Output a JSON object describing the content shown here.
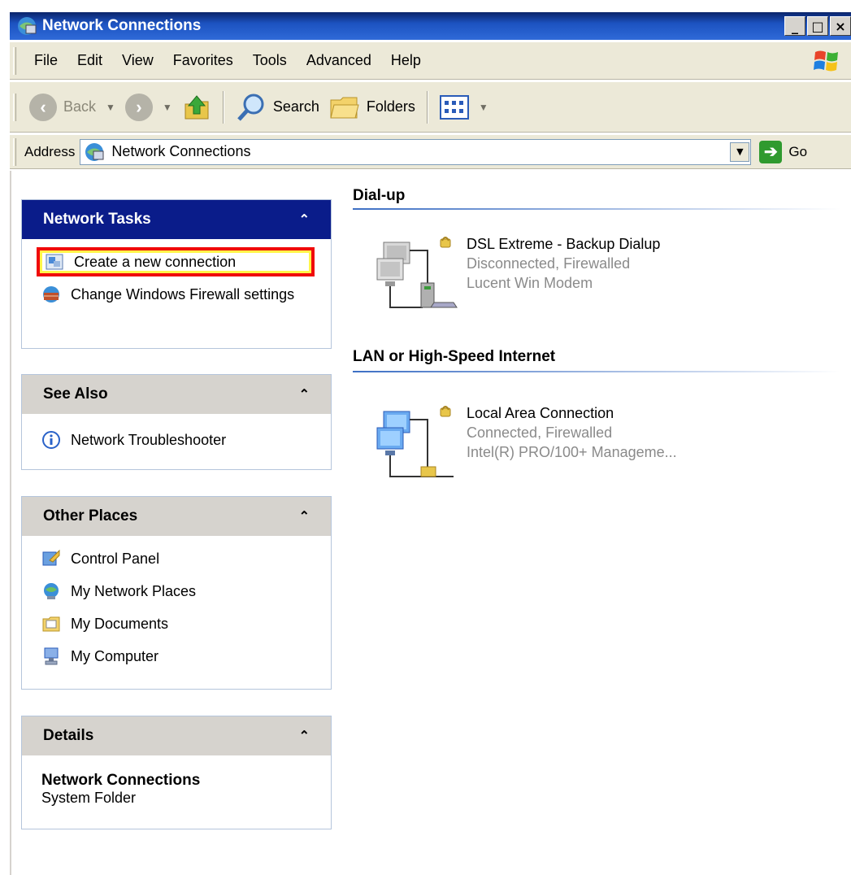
{
  "window": {
    "title": "Network Connections",
    "buttons": [
      "_",
      "□",
      "×"
    ]
  },
  "menubar": {
    "items": [
      "File",
      "Edit",
      "View",
      "Favorites",
      "Tools",
      "Advanced",
      "Help"
    ]
  },
  "toolbar": {
    "back_label": "Back",
    "search_label": "Search",
    "folders_label": "Folders"
  },
  "addressbar": {
    "label": "Address",
    "value": "Network Connections",
    "go_label": "Go"
  },
  "sidebar": {
    "network_tasks": {
      "title": "Network Tasks",
      "items": [
        {
          "label": "Create a new connection",
          "icon": "new-connection-icon"
        },
        {
          "label": "Change Windows Firewall settings",
          "icon": "firewall-icon"
        }
      ]
    },
    "see_also": {
      "title": "See Also",
      "items": [
        {
          "label": "Network Troubleshooter",
          "icon": "info-icon"
        }
      ]
    },
    "other_places": {
      "title": "Other Places",
      "items": [
        {
          "label": "Control Panel",
          "icon": "control-panel-icon"
        },
        {
          "label": "My Network Places",
          "icon": "network-places-icon"
        },
        {
          "label": "My Documents",
          "icon": "documents-icon"
        },
        {
          "label": "My Computer",
          "icon": "computer-icon"
        }
      ]
    },
    "details": {
      "title": "Details",
      "name": "Network Connections",
      "type": "System Folder"
    }
  },
  "main": {
    "groups": [
      {
        "title": "Dial-up",
        "connections": [
          {
            "name": "DSL Extreme - Backup Dialup",
            "status": "Disconnected, Firewalled",
            "device": "Lucent Win Modem"
          }
        ]
      },
      {
        "title": "LAN or High-Speed Internet",
        "connections": [
          {
            "name": "Local Area Connection",
            "status": "Connected, Firewalled",
            "device": "Intel(R) PRO/100+ Manageme..."
          }
        ]
      }
    ]
  },
  "colors": {
    "title_bar": "#1c52c0",
    "special_panel_header": "#0a1c8a",
    "highlight_border": "#f00a0a",
    "highlight_inner": "#fff64a"
  }
}
